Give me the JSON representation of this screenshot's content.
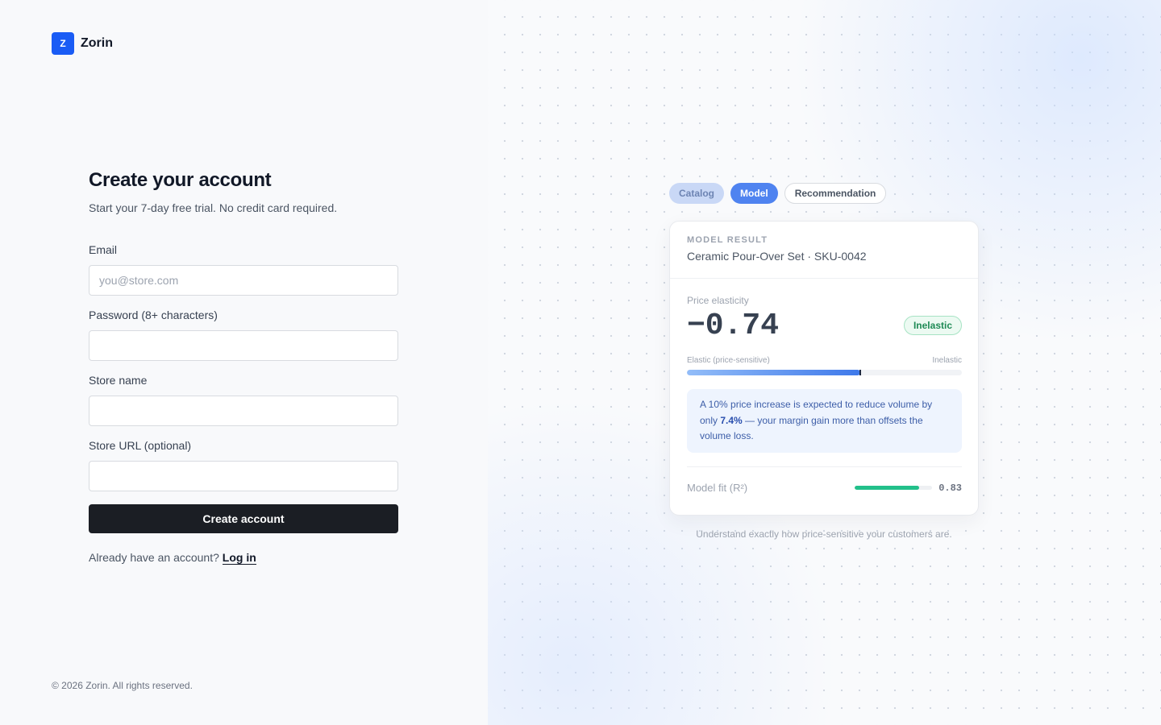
{
  "brand": {
    "mark": "Z",
    "name": "Zorin"
  },
  "form": {
    "title": "Create your account",
    "subtitle": "Start your 7-day free trial. No credit card required.",
    "fields": [
      {
        "label": "Email",
        "value": "",
        "placeholder": "you@store.com"
      },
      {
        "label": "Password (8+ characters)",
        "value": "",
        "placeholder": ""
      },
      {
        "label": "Store name",
        "value": "",
        "placeholder": ""
      },
      {
        "label": "Store URL (optional)",
        "value": "",
        "placeholder": ""
      }
    ],
    "submit_label": "Create account",
    "login_prompt": "Already have an account?",
    "login_link": "Log in"
  },
  "footer": {
    "copyright": "© 2026 Zorin. All rights reserved."
  },
  "preview": {
    "tabs": [
      {
        "label": "Catalog",
        "state": "done"
      },
      {
        "label": "Model",
        "state": "active"
      },
      {
        "label": "Recommendation",
        "state": "upcoming"
      }
    ],
    "card": {
      "eyebrow": "MODEL RESULT",
      "product": "Ceramic Pour-Over Set · SKU-0042",
      "metric_label": "Price elasticity",
      "metric_value": "−0.74",
      "badge": "Inelastic",
      "scale_left": "Elastic (price-sensitive)",
      "scale_right": "Inelastic",
      "scale_position": 0.63,
      "insight_pre": "A 10% price increase is expected to reduce volume by only ",
      "insight_bold": "7.4%",
      "insight_post": " — your margin gain more than offsets the volume loss.",
      "fit_label": "Model fit (R²)",
      "fit_value": "0.83",
      "fit_fraction": 0.83
    },
    "caption": "Understand exactly how price-sensitive your customers are."
  },
  "colors": {
    "brand": "#1a5cf5",
    "button": "#1b1e24",
    "active_tab": "#4f83f0",
    "badge_green": "#1e8a55",
    "fit_bar": "#22c08a"
  }
}
